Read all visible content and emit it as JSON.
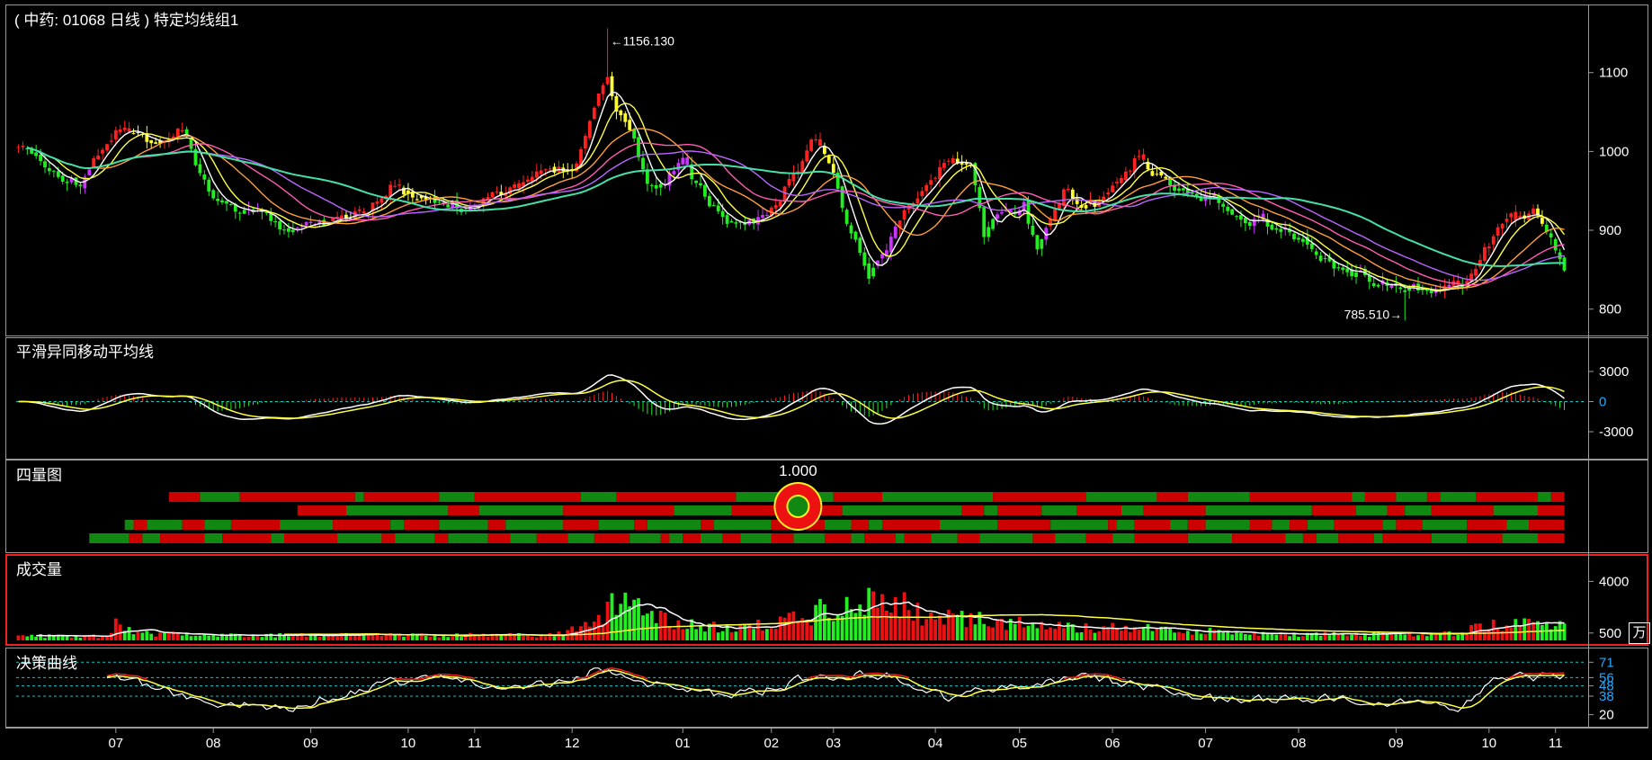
{
  "chart_data": [
    {
      "panel": "price",
      "type": "candlestick",
      "title": "( 中药: 01068 日线 ) 特定均线组1",
      "ylim": [
        770,
        1175
      ],
      "y_ticks": [
        "800",
        "900",
        "1000",
        "1100"
      ],
      "high_marker": "←1156.130",
      "low_marker": "785.510→",
      "moving_average_colors": [
        "#ffffff",
        "#ffff44",
        "#ff9e3d",
        "#ff5db1",
        "#bb66ff",
        "#44e0a8"
      ],
      "path_anchors": [
        [
          0,
          1005
        ],
        [
          8,
          975
        ],
        [
          14,
          958
        ],
        [
          22,
          1030
        ],
        [
          30,
          1010
        ],
        [
          33,
          1020
        ],
        [
          36,
          1035
        ],
        [
          44,
          935
        ],
        [
          54,
          915
        ],
        [
          60,
          905
        ],
        [
          68,
          910
        ],
        [
          78,
          925
        ],
        [
          84,
          955
        ],
        [
          93,
          935
        ],
        [
          101,
          930
        ],
        [
          108,
          950
        ],
        [
          115,
          960
        ],
        [
          120,
          975
        ],
        [
          126,
          985
        ],
        [
          131,
          1070
        ],
        [
          133,
          1100
        ],
        [
          135,
          1055
        ],
        [
          139,
          1005
        ],
        [
          142,
          950
        ],
        [
          147,
          970
        ],
        [
          150,
          985
        ],
        [
          152,
          965
        ],
        [
          160,
          905
        ],
        [
          167,
          915
        ],
        [
          172,
          945
        ],
        [
          177,
          990
        ],
        [
          180,
          1015
        ],
        [
          184,
          960
        ],
        [
          187,
          910
        ],
        [
          192,
          840
        ],
        [
          195,
          865
        ],
        [
          201,
          935
        ],
        [
          205,
          955
        ],
        [
          209,
          985
        ],
        [
          215,
          985
        ],
        [
          218,
          890
        ],
        [
          222,
          925
        ],
        [
          227,
          935
        ],
        [
          230,
          870
        ],
        [
          236,
          945
        ],
        [
          243,
          935
        ],
        [
          249,
          970
        ],
        [
          253,
          995
        ],
        [
          256,
          975
        ],
        [
          264,
          940
        ],
        [
          270,
          940
        ],
        [
          278,
          920
        ],
        [
          287,
          900
        ],
        [
          293,
          870
        ],
        [
          302,
          845
        ],
        [
          310,
          830
        ],
        [
          318,
          820
        ],
        [
          326,
          835
        ],
        [
          330,
          870
        ],
        [
          336,
          915
        ],
        [
          343,
          920
        ],
        [
          347,
          880
        ],
        [
          349,
          850
        ]
      ]
    },
    {
      "panel": "macd",
      "type": "line",
      "title": "平滑异同移动平均线",
      "ylim": [
        -5500,
        5500
      ],
      "y_ticks": [
        "3000",
        "0",
        "-3000"
      ]
    },
    {
      "panel": "quadrant",
      "type": "heatmap",
      "title": "四量图",
      "value_label": "1.000",
      "row_starts": [
        34,
        63,
        24,
        16
      ],
      "colors": {
        "red": "#cc0000",
        "green": "#118811"
      }
    },
    {
      "panel": "volume",
      "type": "bar",
      "title": "成交量",
      "ylim": [
        0,
        5000
      ],
      "y_ticks": [
        "4000",
        "500"
      ],
      "unit": "万",
      "volume_anchors": [
        [
          0,
          300
        ],
        [
          20,
          300
        ],
        [
          22,
          1300
        ],
        [
          24,
          900
        ],
        [
          30,
          450
        ],
        [
          60,
          350
        ],
        [
          120,
          350
        ],
        [
          130,
          1000
        ],
        [
          134,
          2300
        ],
        [
          140,
          2200
        ],
        [
          150,
          1100
        ],
        [
          160,
          800
        ],
        [
          176,
          1400
        ],
        [
          180,
          1900
        ],
        [
          188,
          2200
        ],
        [
          194,
          2600
        ],
        [
          198,
          2800
        ],
        [
          205,
          1500
        ],
        [
          220,
          1300
        ],
        [
          240,
          850
        ],
        [
          260,
          750
        ],
        [
          280,
          450
        ],
        [
          300,
          400
        ],
        [
          325,
          500
        ],
        [
          332,
          1100
        ],
        [
          340,
          1200
        ],
        [
          349,
          1200
        ]
      ]
    },
    {
      "panel": "decision",
      "type": "line",
      "title": "决策曲线",
      "ylim": [
        10,
        80
      ],
      "y_ticks": [
        "71",
        "56",
        "48",
        "38",
        "20"
      ],
      "path_anchors": [
        [
          0,
          42
        ],
        [
          22,
          60
        ],
        [
          30,
          45
        ],
        [
          45,
          32
        ],
        [
          62,
          28
        ],
        [
          80,
          48
        ],
        [
          95,
          56
        ],
        [
          108,
          45
        ],
        [
          120,
          52
        ],
        [
          131,
          64
        ],
        [
          135,
          63
        ],
        [
          142,
          50
        ],
        [
          160,
          36
        ],
        [
          177,
          54
        ],
        [
          195,
          60
        ],
        [
          210,
          36
        ],
        [
          222,
          46
        ],
        [
          240,
          58
        ],
        [
          256,
          45
        ],
        [
          270,
          34
        ],
        [
          290,
          36
        ],
        [
          310,
          32
        ],
        [
          320,
          28
        ],
        [
          326,
          25
        ],
        [
          332,
          52
        ],
        [
          340,
          56
        ],
        [
          349,
          58
        ]
      ]
    },
    {
      "panel": "x-axis",
      "type": "axis",
      "month_labels": [
        "07",
        "08",
        "09",
        "10",
        "11",
        "12",
        "01",
        "02",
        "03",
        "04",
        "05",
        "06",
        "07",
        "08",
        "09",
        "10",
        "11"
      ],
      "month_positions": [
        22,
        44,
        66,
        88,
        103,
        125,
        150,
        170,
        184,
        207,
        226,
        247,
        268,
        289,
        311,
        332,
        347
      ]
    }
  ]
}
